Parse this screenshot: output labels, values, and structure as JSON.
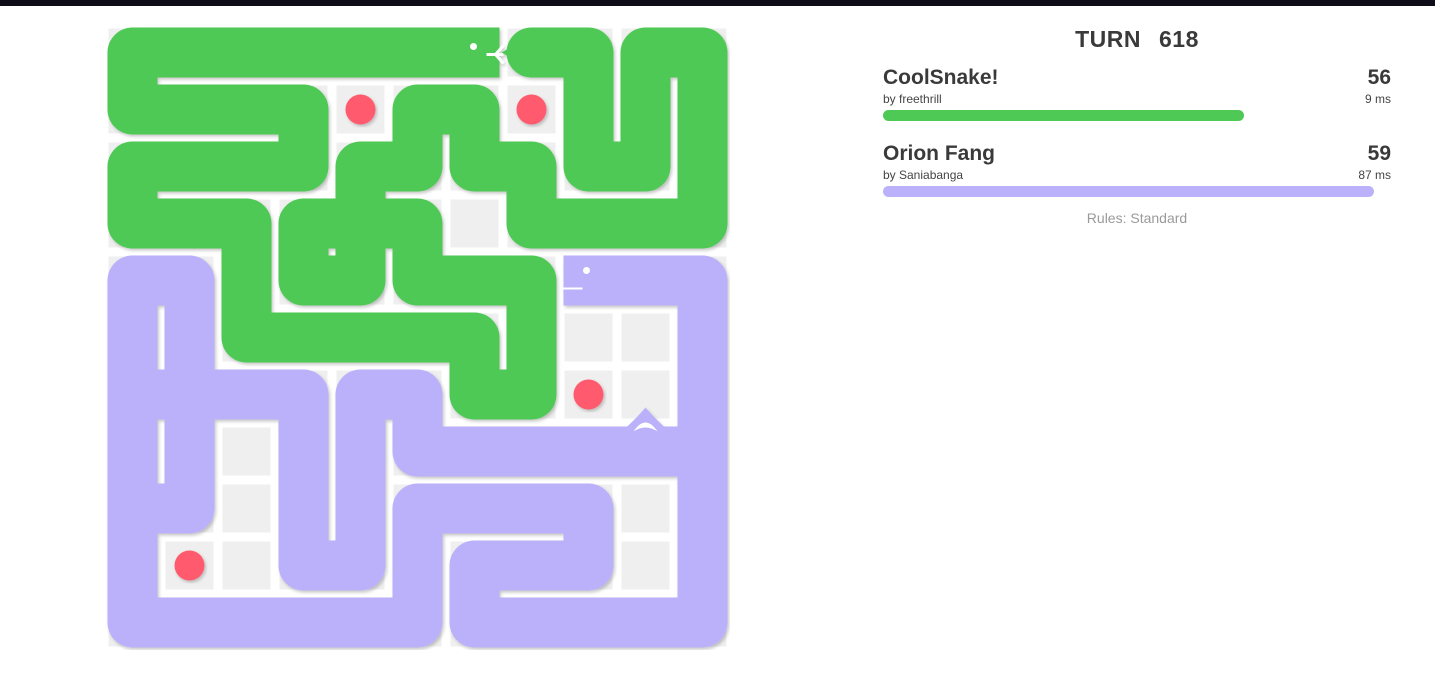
{
  "game": {
    "turn_label": "TURN",
    "turn_number": "618",
    "rules_text": "Rules: Standard"
  },
  "board": {
    "columns": 11,
    "rows": 11,
    "empty_cell_color": "#efefef",
    "food_color": "#ff5a6e",
    "food": [
      [
        4,
        1
      ],
      [
        7,
        1
      ],
      [
        8,
        6
      ],
      [
        1,
        9
      ]
    ]
  },
  "players": [
    {
      "name": "CoolSnake!",
      "author": "by freethrill",
      "score": "56",
      "latency": "9 ms",
      "color": "#4fc955",
      "health": 0.725,
      "head_icon": "snake-head-with-tongue-icon",
      "tail_icon": "arrow-tail-icon",
      "body": [
        [
          6,
          0
        ],
        [
          5,
          0
        ],
        [
          4,
          0
        ],
        [
          3,
          0
        ],
        [
          2,
          0
        ],
        [
          1,
          0
        ],
        [
          0,
          0
        ],
        [
          0,
          1
        ],
        [
          1,
          1
        ],
        [
          2,
          1
        ],
        [
          3,
          1
        ],
        [
          3,
          2
        ],
        [
          2,
          2
        ],
        [
          1,
          2
        ],
        [
          0,
          2
        ],
        [
          0,
          3
        ],
        [
          1,
          3
        ],
        [
          2,
          3
        ],
        [
          2,
          4
        ],
        [
          2,
          5
        ],
        [
          3,
          5
        ],
        [
          4,
          5
        ],
        [
          5,
          5
        ],
        [
          6,
          5
        ],
        [
          6,
          6
        ],
        [
          7,
          6
        ],
        [
          7,
          5
        ],
        [
          7,
          4
        ],
        [
          6,
          4
        ],
        [
          5,
          4
        ],
        [
          5,
          3
        ],
        [
          4,
          3
        ],
        [
          3,
          3
        ],
        [
          3,
          4
        ],
        [
          4,
          4
        ],
        [
          4,
          3
        ],
        [
          4,
          2
        ],
        [
          5,
          2
        ],
        [
          5,
          1
        ],
        [
          6,
          1
        ],
        [
          6,
          2
        ],
        [
          7,
          2
        ],
        [
          7,
          3
        ],
        [
          8,
          3
        ],
        [
          9,
          3
        ],
        [
          10,
          3
        ],
        [
          10,
          2
        ],
        [
          10,
          1
        ],
        [
          10,
          0
        ],
        [
          9,
          0
        ],
        [
          9,
          1
        ],
        [
          9,
          2
        ],
        [
          8,
          2
        ],
        [
          8,
          1
        ],
        [
          8,
          0
        ],
        [
          7,
          0
        ]
      ]
    },
    {
      "name": "Orion Fang",
      "author": "by Saniabanga",
      "score": "59",
      "latency": "87 ms",
      "color": "#bbb0fa",
      "health": 0.985,
      "head_icon": "snake-head-icon",
      "tail_icon": "fang-tail-icon",
      "body": [
        [
          8,
          4
        ],
        [
          9,
          4
        ],
        [
          10,
          4
        ],
        [
          10,
          5
        ],
        [
          10,
          6
        ],
        [
          10,
          7
        ],
        [
          9,
          7
        ],
        [
          8,
          7
        ],
        [
          7,
          7
        ],
        [
          6,
          7
        ],
        [
          5,
          7
        ],
        [
          5,
          6
        ],
        [
          4,
          6
        ],
        [
          4,
          7
        ],
        [
          4,
          8
        ],
        [
          4,
          9
        ],
        [
          3,
          9
        ],
        [
          3,
          8
        ],
        [
          3,
          7
        ],
        [
          3,
          6
        ],
        [
          2,
          6
        ],
        [
          1,
          6
        ],
        [
          1,
          7
        ],
        [
          1,
          8
        ],
        [
          0,
          8
        ],
        [
          0,
          7
        ],
        [
          0,
          6
        ],
        [
          0,
          5
        ],
        [
          0,
          4
        ],
        [
          1,
          4
        ],
        [
          1,
          5
        ],
        [
          1,
          6
        ],
        [
          0,
          6
        ],
        [
          0,
          7
        ],
        [
          0,
          8
        ],
        [
          0,
          9
        ],
        [
          0,
          10
        ],
        [
          1,
          10
        ],
        [
          2,
          10
        ],
        [
          3,
          10
        ],
        [
          4,
          10
        ],
        [
          5,
          10
        ],
        [
          5,
          9
        ],
        [
          5,
          8
        ],
        [
          6,
          8
        ],
        [
          7,
          8
        ],
        [
          8,
          8
        ],
        [
          8,
          9
        ],
        [
          7,
          9
        ],
        [
          6,
          9
        ],
        [
          6,
          10
        ],
        [
          7,
          10
        ],
        [
          8,
          10
        ],
        [
          9,
          10
        ],
        [
          10,
          10
        ],
        [
          10,
          9
        ],
        [
          10,
          8
        ],
        [
          10,
          7
        ],
        [
          9,
          7
        ]
      ]
    }
  ]
}
